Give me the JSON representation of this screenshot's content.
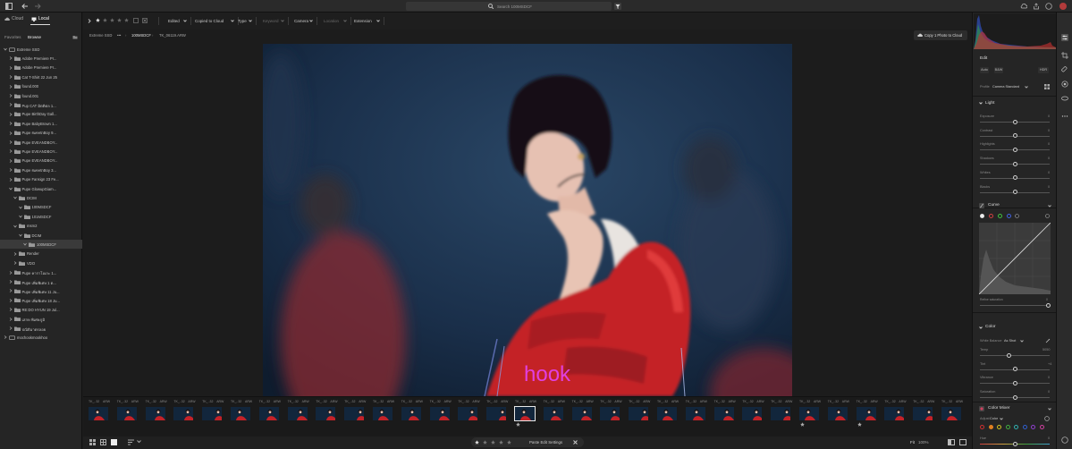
{
  "search": {
    "placeholder": "Search 100MSDCF"
  },
  "left_panel": {
    "tabs": [
      "Cloud",
      "Local"
    ],
    "subtabs": [
      "Favorites",
      "Browse"
    ],
    "tree": [
      {
        "label": "Extreme SSD",
        "indent": 0,
        "open": true
      },
      {
        "label": "Adobe Premiere Pr...",
        "indent": 1
      },
      {
        "label": "Adobe Premiere Pr...",
        "indent": 1
      },
      {
        "label": "Cat T-Shirt 22 Jun 25",
        "indent": 1
      },
      {
        "label": "found.000",
        "indent": 1
      },
      {
        "label": "found.001",
        "indent": 1
      },
      {
        "label": "Pup CAT มิตติตล 1...",
        "indent": 1
      },
      {
        "label": "Pupe BirthDay Gall...",
        "indent": 1
      },
      {
        "label": "Pupe BabyBrown 1...",
        "indent": 1
      },
      {
        "label": "Pupe sweetnBoy 9...",
        "indent": 1
      },
      {
        "label": "Pupe EVEANDBOY...",
        "indent": 1
      },
      {
        "label": "Pupe EVEANDBOY...",
        "indent": 1
      },
      {
        "label": "Pupe EVEANDBOY...",
        "indent": 1
      },
      {
        "label": "Pupe sweetnBoy 3...",
        "indent": 1
      },
      {
        "label": "Pupe Fansign 23 Fe...",
        "indent": 1
      },
      {
        "label": "Pupe GlowupGiam...",
        "indent": 1,
        "open": true
      },
      {
        "label": "DCIM",
        "indent": 2,
        "open": true
      },
      {
        "label": "100MSDCF",
        "indent": 3,
        "open": true
      },
      {
        "label": "101MSDCF",
        "indent": 3,
        "open": true
      },
      {
        "label": "msm2",
        "indent": 2,
        "open": true
      },
      {
        "label": "DCIM",
        "indent": 3,
        "open": true
      },
      {
        "label": "100MSDCF",
        "indent": 4,
        "open": true,
        "selected": true
      },
      {
        "label": "Render",
        "indent": 2
      },
      {
        "label": "VDO",
        "indent": 2
      },
      {
        "label": "Pupe คาราโอเกะ 1...",
        "indent": 1
      },
      {
        "label": "Pupe เพิ่มพิเศษ 1 ต...",
        "indent": 1
      },
      {
        "label": "Pupe เพิ่มพิเศษ 11 Ju...",
        "indent": 1
      },
      {
        "label": "Pupe เพิ่มพิเศษ 18 Ju...",
        "indent": 1
      },
      {
        "label": "RE:DO HYUN 19 Jul...",
        "indent": 1
      },
      {
        "label": "เสกษ พิเศษภูมิ",
        "indent": 1
      },
      {
        "label": "ปณิธิมาตรลอย",
        "indent": 1
      },
      {
        "label": "mochookmookhoo",
        "indent": 0
      }
    ]
  },
  "filters": {
    "items": [
      {
        "label": "Edited",
        "dim": false
      },
      {
        "label": "Copied to Cloud",
        "dim": false
      },
      {
        "label": "Type",
        "dim": false
      },
      {
        "label": "Keyword",
        "dim": true
      },
      {
        "label": "Camera",
        "dim": false
      },
      {
        "label": "Location",
        "dim": true
      },
      {
        "label": "Extension",
        "dim": false
      }
    ]
  },
  "breadcrumb": {
    "items": [
      "Extreme SSD",
      "•••",
      "100MSDCF",
      "TK_06119.ARW"
    ]
  },
  "viewer": {
    "copy_button": "Copy 1 Photo to Cloud",
    "watermark": "hook"
  },
  "filmstrip": {
    "count": 31,
    "selected_index": 15,
    "caption": "TK_..32",
    "badge": "ARW"
  },
  "bottom": {
    "paste": "Paste Edit Settings",
    "zoom_fit": "Fit",
    "zoom_pct": "100%"
  },
  "edit_panel": {
    "title": "Edit",
    "modes": [
      "Auto",
      "B&W",
      "HDR"
    ],
    "profile_label": "Profile",
    "profile_value": "Camera Standard",
    "light": {
      "title": "Light",
      "sliders": [
        {
          "label": "Exposure",
          "value": "0"
        },
        {
          "label": "Contrast",
          "value": "0"
        },
        {
          "label": "Highlights",
          "value": "0"
        },
        {
          "label": "Shadows",
          "value": "0"
        },
        {
          "label": "Whites",
          "value": "0"
        },
        {
          "label": "Blacks",
          "value": "0"
        }
      ]
    },
    "curve": {
      "title": "Curve",
      "footer": "Refine saturation",
      "footer_val": "0"
    },
    "color": {
      "title": "Color",
      "wb_label": "White Balance",
      "wb_value": "As Shot",
      "sliders": [
        {
          "label": "Temp",
          "value": "5050"
        },
        {
          "label": "Tint",
          "value": "+4"
        },
        {
          "label": "Vibrance",
          "value": "0"
        },
        {
          "label": "Saturation",
          "value": "0"
        }
      ]
    },
    "color_mixer": {
      "title": "Color Mixer",
      "adjust_label": "Adjust",
      "adjust_value": "Color",
      "hue_label": "Hue",
      "hue_value": "0"
    }
  },
  "colors": {
    "accent": "#e040e0",
    "photo_bg": "#1a2d45",
    "jacket": "#c42228"
  }
}
